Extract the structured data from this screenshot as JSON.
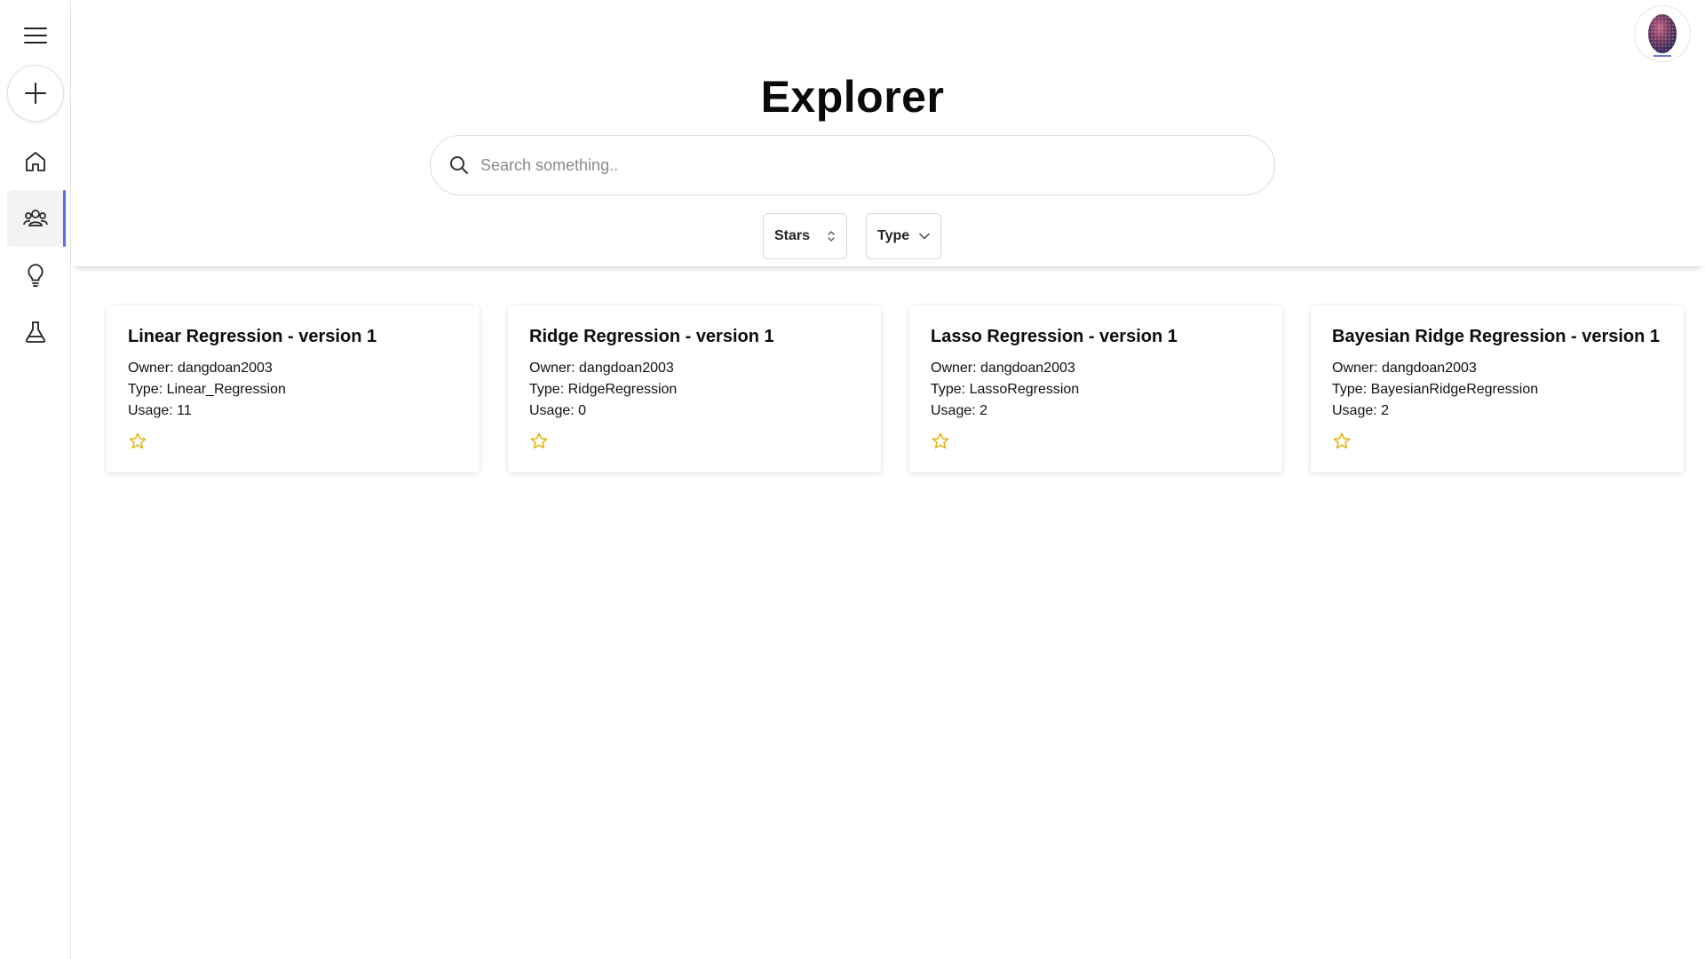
{
  "page": {
    "title": "Explorer"
  },
  "search": {
    "placeholder": "Search something.."
  },
  "filters": {
    "stars_label": "Stars",
    "type_label": "Type"
  },
  "sidebar": {
    "items": [
      {
        "name": "home",
        "icon": "home-icon"
      },
      {
        "name": "community",
        "icon": "users-icon",
        "active": true
      },
      {
        "name": "ideas",
        "icon": "lightbulb-icon"
      },
      {
        "name": "lab",
        "icon": "flask-icon"
      }
    ]
  },
  "colors": {
    "accent": "#6366f1",
    "star": "#e0b000"
  },
  "cards": [
    {
      "title": "Linear Regression - version 1",
      "owner": "Owner: dangdoan2003",
      "type": "Type: Linear_Regression",
      "usage": "Usage: 11"
    },
    {
      "title": "Ridge Regression - version 1",
      "owner": "Owner: dangdoan2003",
      "type": "Type: RidgeRegression",
      "usage": "Usage: 0"
    },
    {
      "title": "Lasso Regression - version 1",
      "owner": "Owner: dangdoan2003",
      "type": "Type: LassoRegression",
      "usage": "Usage: 2"
    },
    {
      "title": "Bayesian Ridge Regression - version 1",
      "owner": "Owner: dangdoan2003",
      "type": "Type: BayesianRidgeRegression",
      "usage": "Usage: 2"
    }
  ]
}
